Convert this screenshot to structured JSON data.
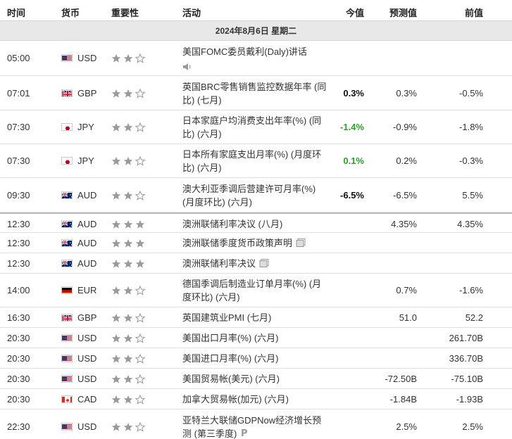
{
  "header": {
    "time": "时间",
    "currency": "货币",
    "importance": "重要性",
    "activity": "活动",
    "actual": "今值",
    "forecast": "预测值",
    "previous": "前值"
  },
  "date_band": "2024年8月6日  星期二",
  "rows": [
    {
      "time": "05:00",
      "flag": "us",
      "currency": "USD",
      "stars": 2,
      "activity": "美国FOMC委员戴利(Daly)讲话",
      "icon": "speaker-icon",
      "actual": "",
      "forecast": "",
      "previous": "",
      "h": 50
    },
    {
      "time": "07:01",
      "flag": "gb",
      "currency": "GBP",
      "stars": 2,
      "activity": "英国BRC零售销售监控数据年率 (同比) (七月)",
      "actual": "0.3%",
      "actual_color": "#111111",
      "forecast": "0.3%",
      "previous": "-0.5%",
      "h": 49
    },
    {
      "time": "07:30",
      "flag": "jp",
      "currency": "JPY",
      "stars": 2,
      "activity": "日本家庭户均消费支出年率(%) (同比) (六月)",
      "actual": "-1.4%",
      "actual_color": "#2e9e2e",
      "forecast": "-0.9%",
      "previous": "-1.8%",
      "h": 48
    },
    {
      "time": "07:30",
      "flag": "jp",
      "currency": "JPY",
      "stars": 2,
      "activity": "日本所有家庭支出月率(%) (月度环比) (六月)",
      "actual": "0.1%",
      "actual_color": "#2e9e2e",
      "forecast": "0.2%",
      "previous": "-0.3%",
      "h": 48
    },
    {
      "time": "09:30",
      "flag": "au",
      "currency": "AUD",
      "stars": 2,
      "activity": "澳大利亚季调后营建许可月率(%) (月度环比) (六月)",
      "actual": "-6.5%",
      "actual_color": "#111111",
      "forecast": "-6.5%",
      "previous": "5.5%",
      "h": 49
    },
    {
      "time": "12:30",
      "flag": "au",
      "currency": "AUD",
      "stars": 3,
      "activity": "澳洲联储利率决议 (八月)",
      "actual": "",
      "forecast": "4.35%",
      "previous": "4.35%",
      "h": 29,
      "sep": true
    },
    {
      "time": "12:30",
      "flag": "au",
      "currency": "AUD",
      "stars": 3,
      "activity": "澳洲联储季度货币政策声明",
      "icon": "document-icon",
      "actual": "",
      "forecast": "",
      "previous": "",
      "h": 29
    },
    {
      "time": "12:30",
      "flag": "au",
      "currency": "AUD",
      "stars": 3,
      "activity": "澳洲联储利率决议",
      "icon": "document-icon",
      "actual": "",
      "forecast": "",
      "previous": "",
      "h": 29
    },
    {
      "time": "14:00",
      "flag": "de",
      "currency": "EUR",
      "stars": 2,
      "activity": "德国季调后制造业订单月率(%) (月度环比) (六月)",
      "actual": "",
      "forecast": "0.7%",
      "previous": "-1.6%",
      "h": 48
    },
    {
      "time": "16:30",
      "flag": "gb",
      "currency": "GBP",
      "stars": 2,
      "activity": "英国建筑业PMI (七月)",
      "actual": "",
      "forecast": "51.0",
      "previous": "52.2",
      "h": 29
    },
    {
      "time": "20:30",
      "flag": "us",
      "currency": "USD",
      "stars": 2,
      "activity": "美国出口月率(%) (六月)",
      "actual": "",
      "forecast": "",
      "previous": "261.70B",
      "h": 29
    },
    {
      "time": "20:30",
      "flag": "us",
      "currency": "USD",
      "stars": 2,
      "activity": "美国进口月率(%) (六月)",
      "actual": "",
      "forecast": "",
      "previous": "336.70B",
      "h": 29
    },
    {
      "time": "20:30",
      "flag": "us",
      "currency": "USD",
      "stars": 2,
      "activity": "美国贸易帐(美元) (六月)",
      "actual": "",
      "forecast": "-72.50B",
      "previous": "-75.10B",
      "h": 29
    },
    {
      "time": "20:30",
      "flag": "ca",
      "currency": "CAD",
      "stars": 2,
      "activity": "加拿大贸易帐(加元) (六月)",
      "actual": "",
      "forecast": "-1.84B",
      "previous": "-1.93B",
      "h": 29
    },
    {
      "time": "22:30",
      "flag": "us",
      "currency": "USD",
      "stars": 2,
      "activity": "亚特兰大联储GDPNow经济增长预测 (第三季度)",
      "icon": "preliminary-icon",
      "actual": "",
      "forecast": "2.5%",
      "previous": "2.5%",
      "h": 49
    }
  ]
}
